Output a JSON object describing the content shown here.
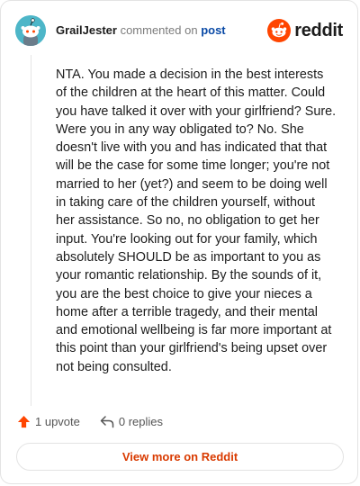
{
  "comment": {
    "author": "GrailJester",
    "verb": "commented on",
    "post_link": "post",
    "brand": "reddit",
    "body": "NTA. You made a decision in the best interests of the children at the heart of this matter. Could you have talked it over with your girlfriend? Sure. Were you in any way obligated to? No. She doesn't live with you and has indicated that that will be the case for some time longer; you're not married to her (yet?) and seem to be doing well in taking care of the children yourself, without her assistance. So no, no obligation to get her input. You're looking out for your family, which absolutely SHOULD be as important to you as your romantic relationship. By the sounds of it, you are the best choice to give your nieces a home after a terrible tragedy, and their mental and emotional wellbeing is far more important at this point than your girlfriend's being upset over not being consulted.",
    "upvotes_label": "1 upvote",
    "replies_label": "0 replies",
    "view_more_label": "View more on Reddit"
  },
  "colors": {
    "accent": "#ff4500",
    "link": "#0a4aa6",
    "avatar_bg": "#4db6c8"
  },
  "icons": {
    "avatar": "snoo-avatar",
    "brand": "reddit-logo-icon",
    "upvote": "upvote-arrow-icon",
    "reply": "reply-arrow-icon"
  }
}
